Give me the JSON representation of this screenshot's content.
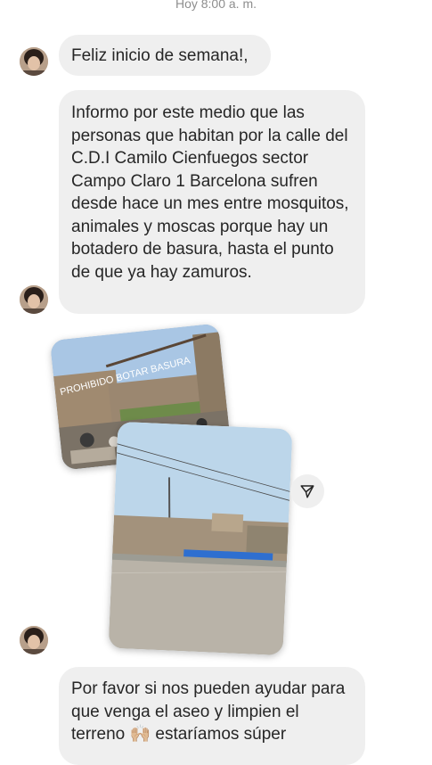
{
  "timestamp": "Hoy 8:00 a. m.",
  "messages": [
    {
      "text": "Feliz inicio de semana!,"
    },
    {
      "text": "Informo por este medio que las personas que habitan por la calle del C.D.I Camilo Cienfuegos sector Campo Claro 1 Barcelona sufren desde hace un mes entre mosquitos, animales y moscas porque hay un botadero de basura, hasta el punto de que ya hay zamuros."
    },
    {
      "text": "Por favor si nos pueden ayudar para que venga el aseo y limpien el terreno 🙌🏼 estaríamos súper"
    }
  ],
  "photos": {
    "sign_text": "PROHIBIDO BOTAR BASURA"
  },
  "icons": {
    "share": "send-icon"
  },
  "colors": {
    "bubble": "#efefef",
    "text": "#262626",
    "timestamp": "#8e8e8e"
  }
}
